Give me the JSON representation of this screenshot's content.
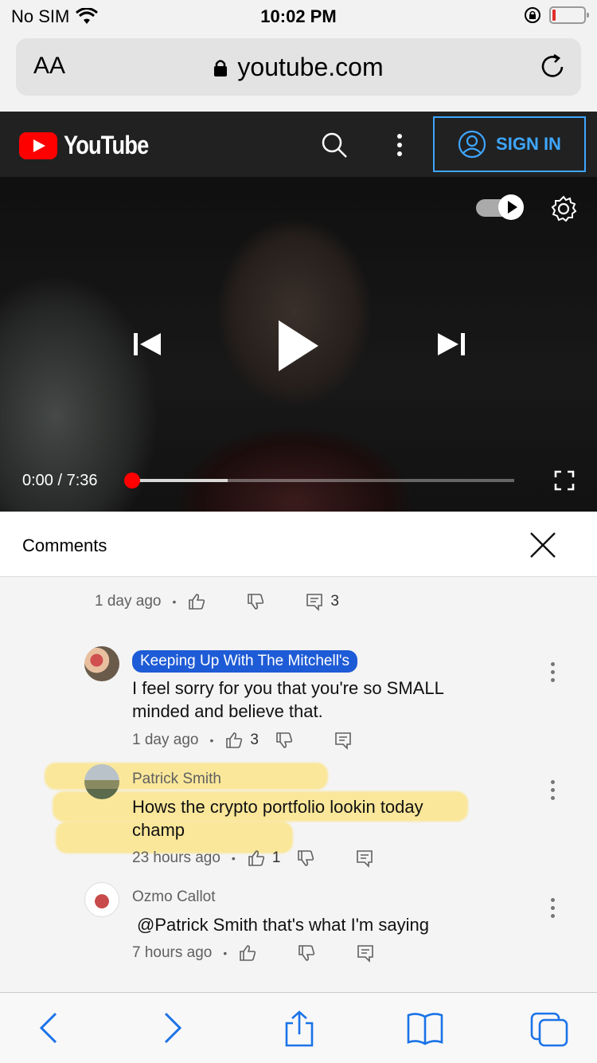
{
  "status_bar": {
    "carrier": "No SIM",
    "time": "10:02 PM"
  },
  "url_bar": {
    "text_size_label": "AA",
    "url": "youtube.com"
  },
  "yt_header": {
    "logo_text": "YouTube",
    "sign_in_label": "SIGN IN"
  },
  "player": {
    "current_time": "0:00",
    "separator": "/",
    "duration": "7:36",
    "progress_fraction": 0.0,
    "buffered_fraction": 0.25
  },
  "comments": {
    "title": "Comments",
    "partial": {
      "ago": "1 day ago",
      "reply_count": "3"
    },
    "items": [
      {
        "author": "Keeping Up With The Mitchell's",
        "text_line1": "I feel sorry for you that you're so SMALL",
        "text_line2": "minded and believe that.",
        "ago": "1 day ago",
        "likes": "3"
      },
      {
        "author": "Patrick Smith",
        "text_line1": "Hows the crypto portfolio lookin today",
        "text_line2": "champ",
        "ago": "23 hours ago",
        "likes": "1"
      },
      {
        "author": "Ozmo Callot",
        "text_line1": "@Patrick Smith  that's what I'm saying",
        "ago": "7 hours ago"
      }
    ]
  },
  "colors": {
    "youtube_red": "#ff0000",
    "link_blue": "#3ea6ff",
    "safari_blue": "#1a73e8",
    "highlight": "#ffdd50"
  }
}
